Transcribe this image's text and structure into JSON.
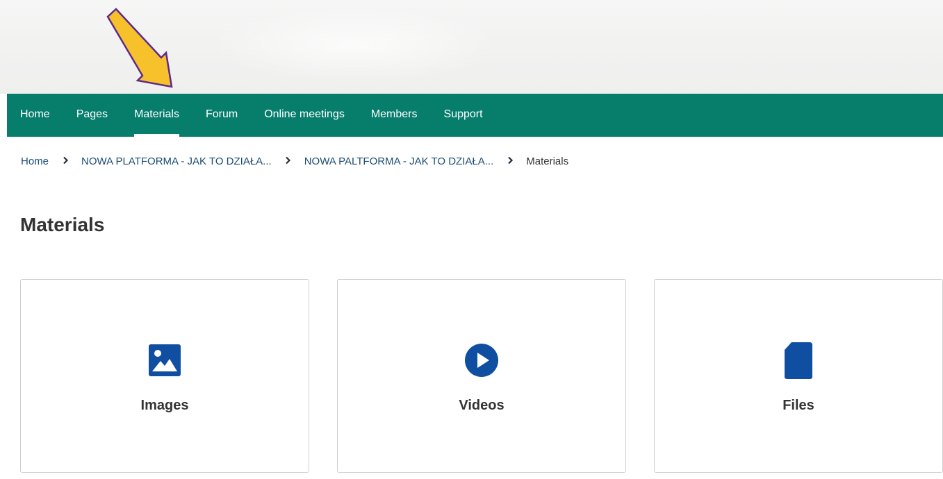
{
  "nav": {
    "items": [
      {
        "label": "Home"
      },
      {
        "label": "Pages"
      },
      {
        "label": "Materials"
      },
      {
        "label": "Forum"
      },
      {
        "label": "Online meetings"
      },
      {
        "label": "Members"
      },
      {
        "label": "Support"
      }
    ],
    "active": "Materials"
  },
  "breadcrumb": {
    "items": [
      "Home",
      "NOWA PLATFORMA - JAK TO DZIAŁA...",
      "NOWA PALTFORMA - JAK TO DZIAŁA...",
      "Materials"
    ]
  },
  "page": {
    "title": "Materials"
  },
  "cards": [
    {
      "label": "Images",
      "icon": "image-icon"
    },
    {
      "label": "Videos",
      "icon": "play-circle-icon"
    },
    {
      "label": "Files",
      "icon": "file-icon"
    }
  ],
  "colors": {
    "nav_background": "#077d6c",
    "icon_blue": "#104ea2",
    "link_blue": "#1b4b73",
    "arrow_fill": "#f6c12b",
    "arrow_outline": "#5b2a8c"
  }
}
